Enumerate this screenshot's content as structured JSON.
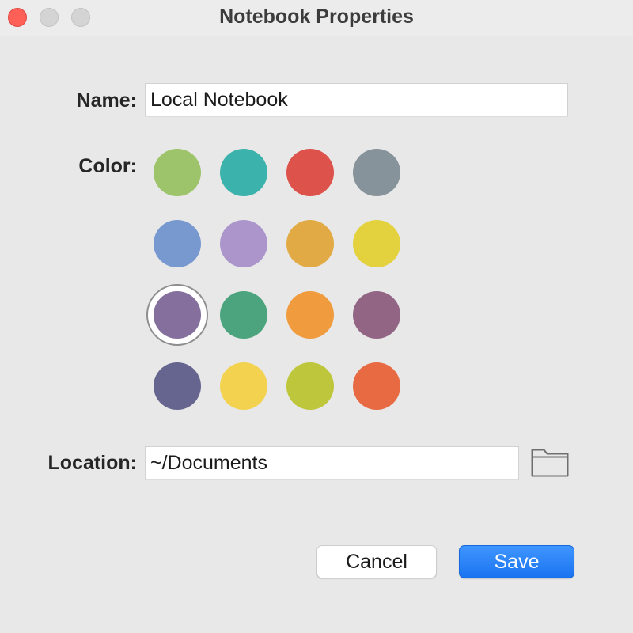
{
  "window": {
    "title": "Notebook Properties"
  },
  "form": {
    "name_label": "Name:",
    "name_value": "Local Notebook",
    "color_label": "Color:",
    "location_label": "Location:",
    "location_value": "~/Documents"
  },
  "colors": {
    "options": [
      "#9dc46a",
      "#3bb3ac",
      "#dd524a",
      "#87939b",
      "#7799d0",
      "#ab95cb",
      "#e1aa44",
      "#e3d13e",
      "#856f9c",
      "#4ba47e",
      "#ef9b3e",
      "#936585",
      "#65658f",
      "#f2d24f",
      "#bec63c",
      "#e86a43"
    ],
    "selected_index": 8
  },
  "buttons": {
    "cancel_label": "Cancel",
    "save_label": "Save"
  },
  "icons": {
    "folder": "folder-icon"
  }
}
